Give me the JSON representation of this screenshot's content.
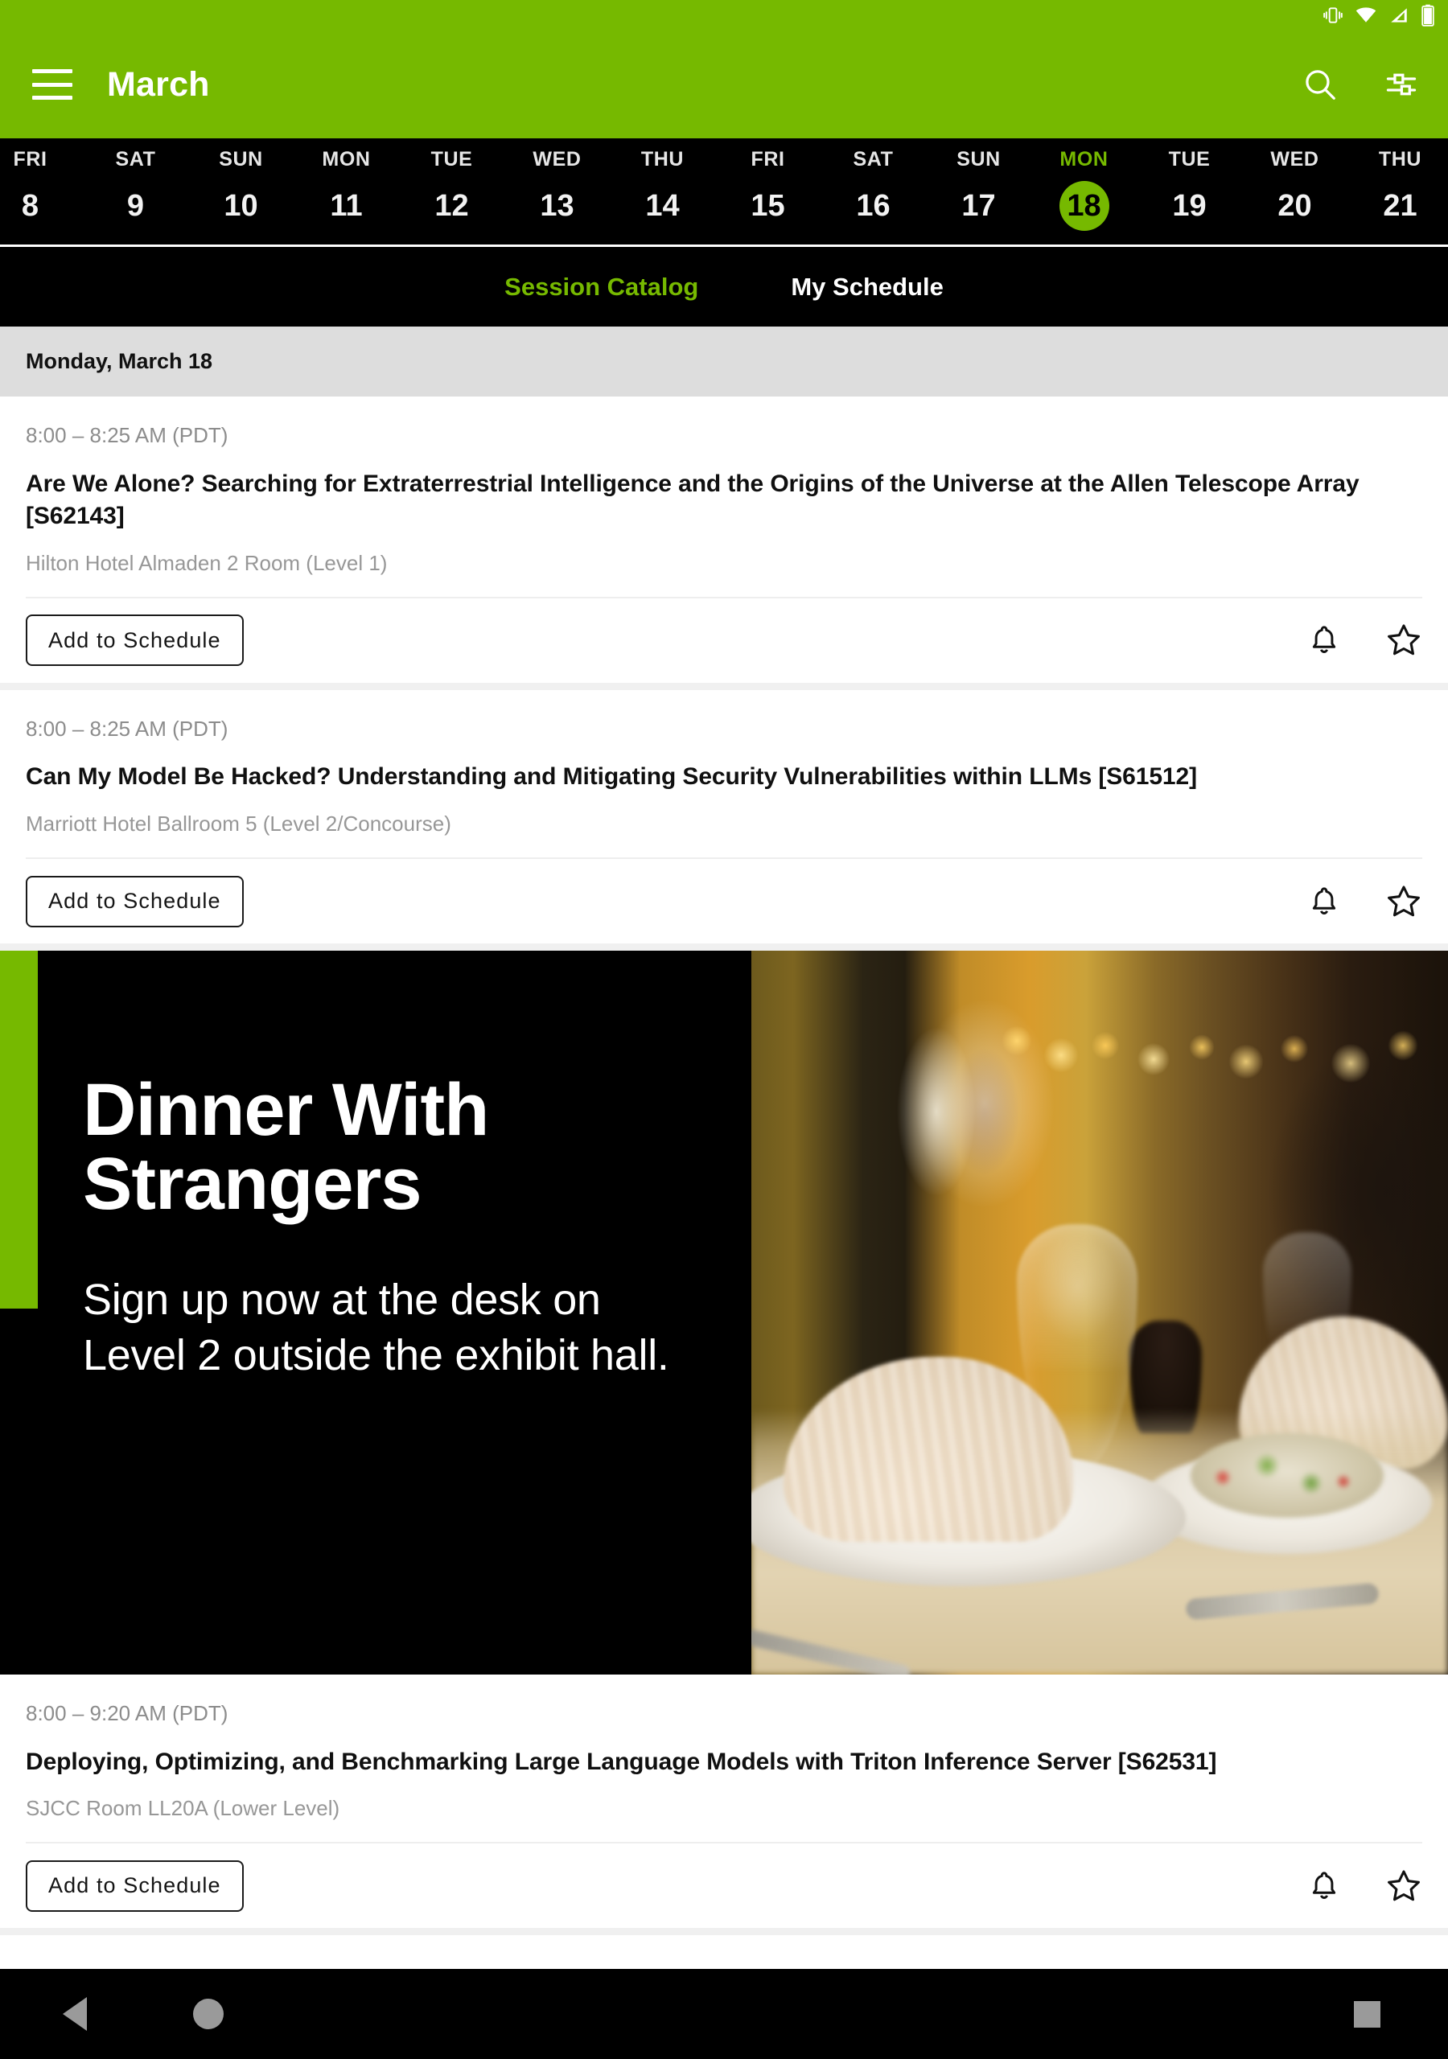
{
  "status_bar": {
    "icons": [
      "vibrate-icon",
      "wifi-icon",
      "cell-signal-icon",
      "battery-icon"
    ]
  },
  "app_bar": {
    "menu_icon": "hamburger-menu-icon",
    "title": "March",
    "search_icon": "search-icon",
    "filter_icon": "filter-sliders-icon"
  },
  "date_strip": {
    "days": [
      {
        "dow": "FRI",
        "num": "8",
        "selected": false
      },
      {
        "dow": "SAT",
        "num": "9",
        "selected": false
      },
      {
        "dow": "SUN",
        "num": "10",
        "selected": false
      },
      {
        "dow": "MON",
        "num": "11",
        "selected": false
      },
      {
        "dow": "TUE",
        "num": "12",
        "selected": false
      },
      {
        "dow": "WED",
        "num": "13",
        "selected": false
      },
      {
        "dow": "THU",
        "num": "14",
        "selected": false
      },
      {
        "dow": "FRI",
        "num": "15",
        "selected": false
      },
      {
        "dow": "SAT",
        "num": "16",
        "selected": false
      },
      {
        "dow": "SUN",
        "num": "17",
        "selected": false
      },
      {
        "dow": "MON",
        "num": "18",
        "selected": true
      },
      {
        "dow": "TUE",
        "num": "19",
        "selected": false
      },
      {
        "dow": "WED",
        "num": "20",
        "selected": false
      },
      {
        "dow": "THU",
        "num": "21",
        "selected": false
      }
    ],
    "selected_date": "18",
    "accent_color": "#76b900"
  },
  "tabs": [
    {
      "label": "Session Catalog",
      "active": true
    },
    {
      "label": "My Schedule",
      "active": false
    }
  ],
  "day_header": "Monday, March 18",
  "sessions": [
    {
      "time": "8:00 – 8:25 AM (PDT)",
      "title": "Are We Alone? Searching for Extraterrestrial Intelligence and the Origins of the Universe at the Allen Telescope Array [S62143]",
      "room": "Hilton Hotel Almaden 2 Room (Level 1)",
      "add_label": "Add to Schedule",
      "bell_icon": "notification-bell-icon",
      "star_icon": "favorite-star-icon"
    },
    {
      "time": "8:00 – 8:25 AM (PDT)",
      "title": "Can My Model Be Hacked? Understanding and Mitigating Security Vulnerabilities within LLMs [S61512]",
      "room": "Marriott Hotel Ballroom 5 (Level 2/Concourse)",
      "add_label": "Add to Schedule",
      "bell_icon": "notification-bell-icon",
      "star_icon": "favorite-star-icon"
    },
    {
      "time": "8:00 – 9:20 AM (PDT)",
      "title": "Deploying, Optimizing, and Benchmarking Large Language Models with Triton Inference Server [S62531]",
      "room": "SJCC Room LL20A (Lower Level)",
      "add_label": "Add to Schedule",
      "bell_icon": "notification-bell-icon",
      "star_icon": "favorite-star-icon"
    }
  ],
  "promo_banner": {
    "title_line1": "Dinner With",
    "title_line2": "Strangers",
    "subtitle": "Sign up now at the desk on Level 2 outside the exhibit hall.",
    "stripe_color": "#76b900",
    "background_color": "#000000",
    "image_description": "blurred restaurant banquet table with folded napkins, plates, salad and wine glasses"
  },
  "nav_bar": {
    "back_icon": "back-triangle-icon",
    "home_icon": "home-circle-icon",
    "recents_icon": "recents-square-icon"
  }
}
